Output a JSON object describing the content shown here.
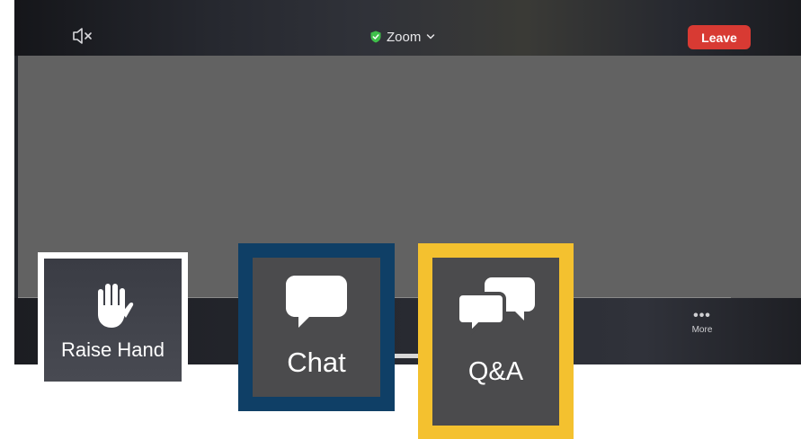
{
  "top_bar": {
    "mute_icon": "speaker-muted-icon",
    "title": "Zoom",
    "secure_icon": "shield-check-icon",
    "secure_color": "#3fbf4a",
    "leave_label": "Leave",
    "leave_color": "#d83a33"
  },
  "bottom_bar": {
    "more_icon": "ellipsis-icon",
    "more_label": "More"
  },
  "callouts": {
    "raise_hand": {
      "label": "Raise Hand",
      "icon": "raised-hand-icon",
      "border_color": "#ffffff"
    },
    "chat": {
      "label": "Chat",
      "icon": "chat-bubble-icon",
      "border_color": "#0f3f66"
    },
    "qa": {
      "label": "Q&A",
      "icon": "qa-bubbles-icon",
      "border_color": "#f4c12f"
    }
  }
}
